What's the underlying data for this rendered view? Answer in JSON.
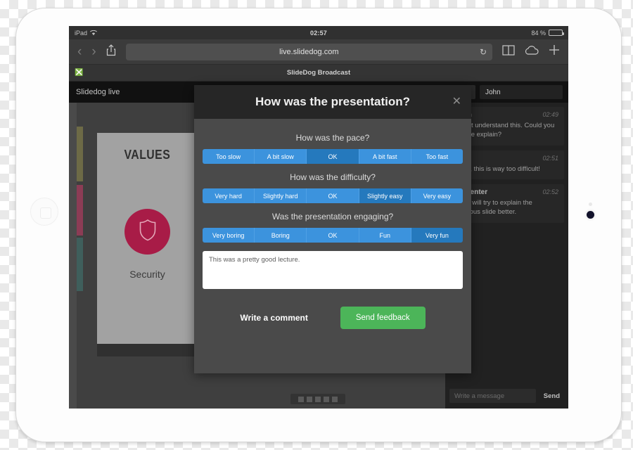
{
  "device": {
    "status_bar": {
      "carrier": "iPad",
      "wifi_icon": "wifi-icon",
      "time": "02:57",
      "battery_label": "84 %",
      "battery_percent": 84
    },
    "browser": {
      "back_icon": "chevron-left-icon",
      "forward_icon": "chevron-right-icon",
      "share_icon": "share-icon",
      "url": "live.slidedog.com",
      "reload_icon": "reload-icon",
      "bookmarks_icon": "book-icon",
      "cloud_icon": "cloud-icon",
      "new_tab_icon": "plus-icon",
      "tab_close_icon": "close-circle-icon",
      "tab_title": "SlideDog Broadcast"
    }
  },
  "app": {
    "header": {
      "brand": "Slidedog live",
      "user_icon": "user-icon",
      "user_name": "John"
    },
    "slide": {
      "title": "VALUES",
      "badge_icon": "shield-icon",
      "caption": "Security",
      "badge_color": "#a81c47",
      "strips": [
        "#6d6a46",
        "#8c3c55",
        "#3f5f5c"
      ],
      "pager_dots": 5
    },
    "chat": {
      "messages": [
        {
          "author": "John",
          "time": "02:49",
          "text": "I don't understand this. Could you please explain?"
        },
        {
          "author": "Lisa",
          "time": "02:51",
          "text": "Yeah, this is way too difficult!"
        },
        {
          "author": "Presenter",
          "time": "02:52",
          "text": "OK, I will try to explain the previous slide better."
        }
      ],
      "input_placeholder": "Write a message",
      "send_label": "Send"
    }
  },
  "modal": {
    "title": "How was the presentation?",
    "close_icon": "close-icon",
    "questions": [
      {
        "label": "How was the pace?",
        "options": [
          "Too slow",
          "A bit slow",
          "OK",
          "A bit fast",
          "Too fast"
        ],
        "selected_index": 2
      },
      {
        "label": "How was the difficulty?",
        "options": [
          "Very hard",
          "Slightly hard",
          "OK",
          "Slightly easy",
          "Very easy"
        ],
        "selected_index": 3
      },
      {
        "label": "Was the presentation engaging?",
        "options": [
          "Very boring",
          "Boring",
          "OK",
          "Fun",
          "Very fun"
        ],
        "selected_index": 4
      }
    ],
    "comment_value": "This was a pretty good lecture.",
    "write_comment_label": "Write a comment",
    "send_feedback_label": "Send feedback",
    "accent_blue": "#3c93dd",
    "selected_blue": "#2579bd",
    "send_green": "#4cb559"
  }
}
